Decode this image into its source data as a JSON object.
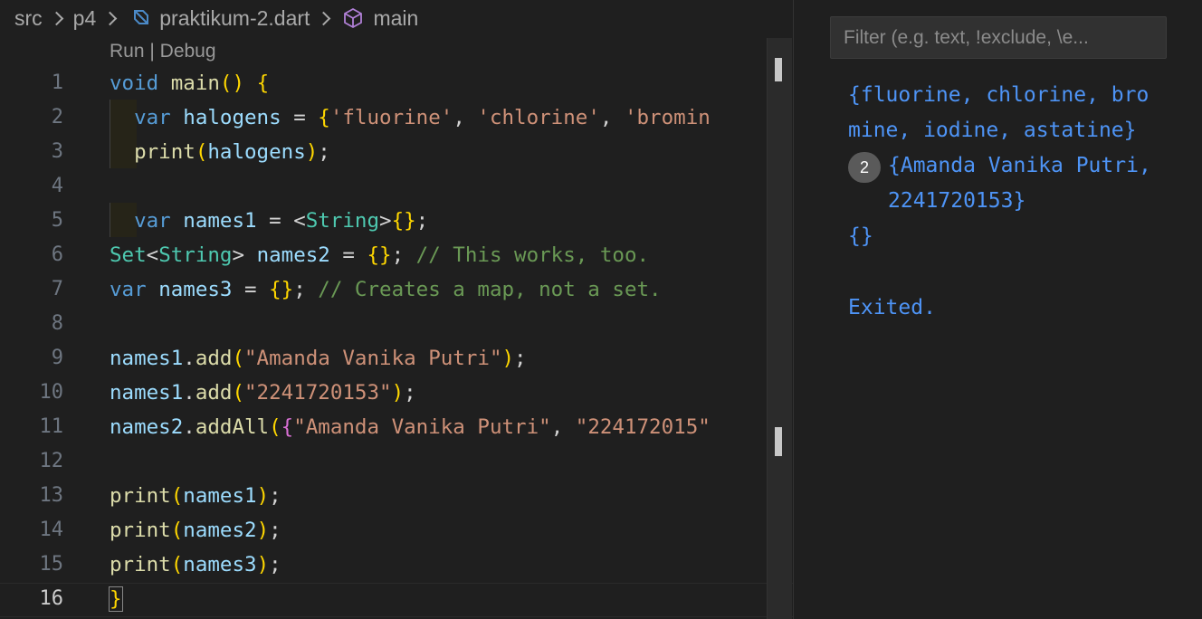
{
  "breadcrumb": {
    "items": [
      "src",
      "p4",
      "praktikum-2.dart",
      "main"
    ]
  },
  "codelens": "Run | Debug",
  "code_lines": [
    {
      "num": "1",
      "text": "void main() {"
    },
    {
      "num": "2",
      "text": "  var halogens = {'fluorine', 'chlorine', 'bromin"
    },
    {
      "num": "3",
      "text": "  print(halogens);"
    },
    {
      "num": "4",
      "text": ""
    },
    {
      "num": "5",
      "text": "  var names1 = <String>{};"
    },
    {
      "num": "6",
      "text": "Set<String> names2 = {}; // This works, too."
    },
    {
      "num": "7",
      "text": "var names3 = {}; // Creates a map, not a set."
    },
    {
      "num": "8",
      "text": ""
    },
    {
      "num": "9",
      "text": "names1.add(\"Amanda Vanika Putri\");"
    },
    {
      "num": "10",
      "text": "names1.add(\"2241720153\");"
    },
    {
      "num": "11",
      "text": "names2.addAll({\"Amanda Vanika Putri\", \"224172015\""
    },
    {
      "num": "12",
      "text": ""
    },
    {
      "num": "13",
      "text": "print(names1);"
    },
    {
      "num": "14",
      "text": "print(names2);"
    },
    {
      "num": "15",
      "text": "print(names3);"
    },
    {
      "num": "16",
      "text": "}"
    }
  ],
  "active_line": "16",
  "output": {
    "filter_placeholder": "Filter (e.g. text, !exclude, \\e...",
    "lines": [
      "{fluorine, chlorine, bro",
      "mine, iodine, astatine}",
      "{Amanda Vanika Putri,",
      "2241720153}",
      "{}",
      "Exited."
    ],
    "repeat_badge": "2"
  },
  "colors": {
    "background": "#1f1f1f",
    "keyword": "#569cd6",
    "string": "#ce9178",
    "comment": "#6a9955",
    "type": "#4ec9b0",
    "output_text": "#4e94f6"
  },
  "icons": [
    "chevron-right-icon",
    "dart-file-icon",
    "symbol-method-icon"
  ]
}
